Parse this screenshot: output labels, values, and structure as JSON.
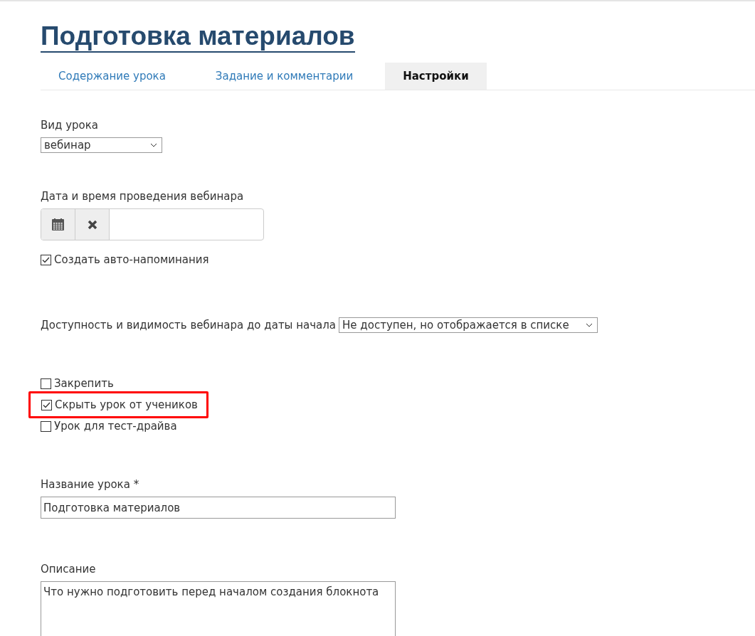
{
  "title": "Подготовка материалов",
  "tabs": [
    {
      "label": "Содержание урока",
      "selected": false
    },
    {
      "label": "Задание и комментарии",
      "selected": false
    },
    {
      "label": "Настройки",
      "selected": true
    }
  ],
  "lesson_type": {
    "label": "Вид урока",
    "value": "вебинар"
  },
  "webinar_date": {
    "label": "Дата и время проведения вебинара"
  },
  "auto_reminders": {
    "label": "Создать авто-напоминания",
    "checked": true
  },
  "availability": {
    "label": "Доступность и видимость вебинара до даты начала",
    "value": "Не доступен, но отображается в списке"
  },
  "options": [
    {
      "label": "Закрепить",
      "checked": false,
      "highlighted": false
    },
    {
      "label": "Скрыть урок от учеников",
      "checked": true,
      "highlighted": true
    },
    {
      "label": "Урок для тест-драйва",
      "checked": false,
      "highlighted": false
    }
  ],
  "lesson_name": {
    "label": "Название урока *",
    "value": "Подготовка материалов"
  },
  "description": {
    "label": "Описание",
    "value": "Что нужно подготовить перед началом создания блокнота"
  }
}
